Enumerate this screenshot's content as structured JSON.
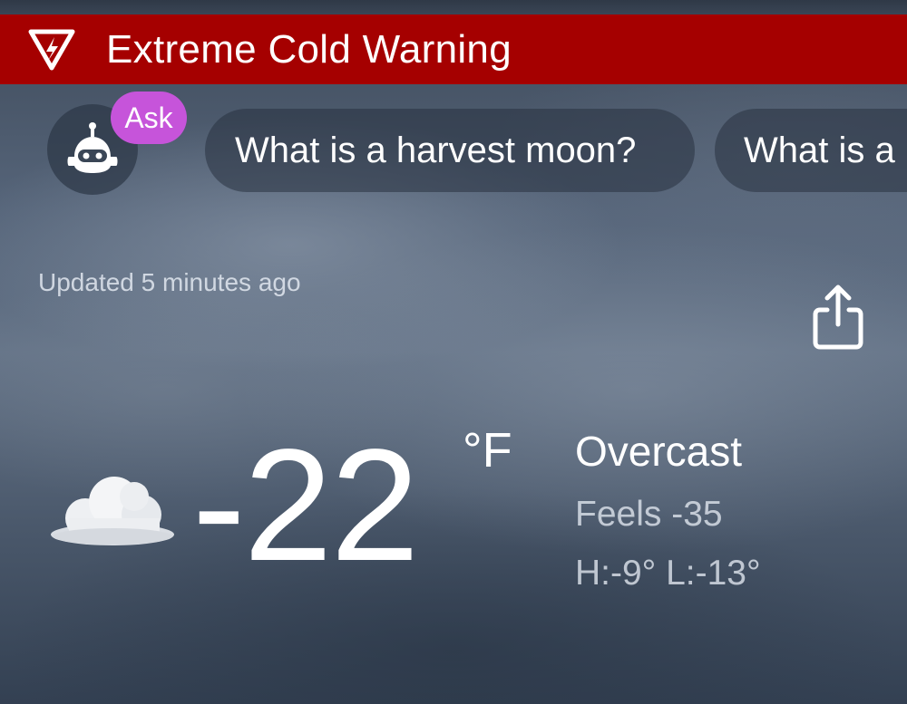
{
  "alert": {
    "title": "Extreme Cold Warning",
    "icon": "warning-triangle-icon",
    "color": "#a50000"
  },
  "assistant": {
    "icon": "robot-icon",
    "badge_label": "Ask",
    "badge_color": "#c654da"
  },
  "suggestions": [
    {
      "label": "What is a harvest moon?"
    },
    {
      "label": "What is a"
    }
  ],
  "status": {
    "updated": "Updated 5 minutes ago"
  },
  "share": {
    "icon": "share-icon"
  },
  "current": {
    "icon": "cloud-icon",
    "temperature": "-22",
    "unit": "°F",
    "condition": "Overcast",
    "feels_like": "Feels -35",
    "high_low": "H:-9° L:-13°"
  }
}
